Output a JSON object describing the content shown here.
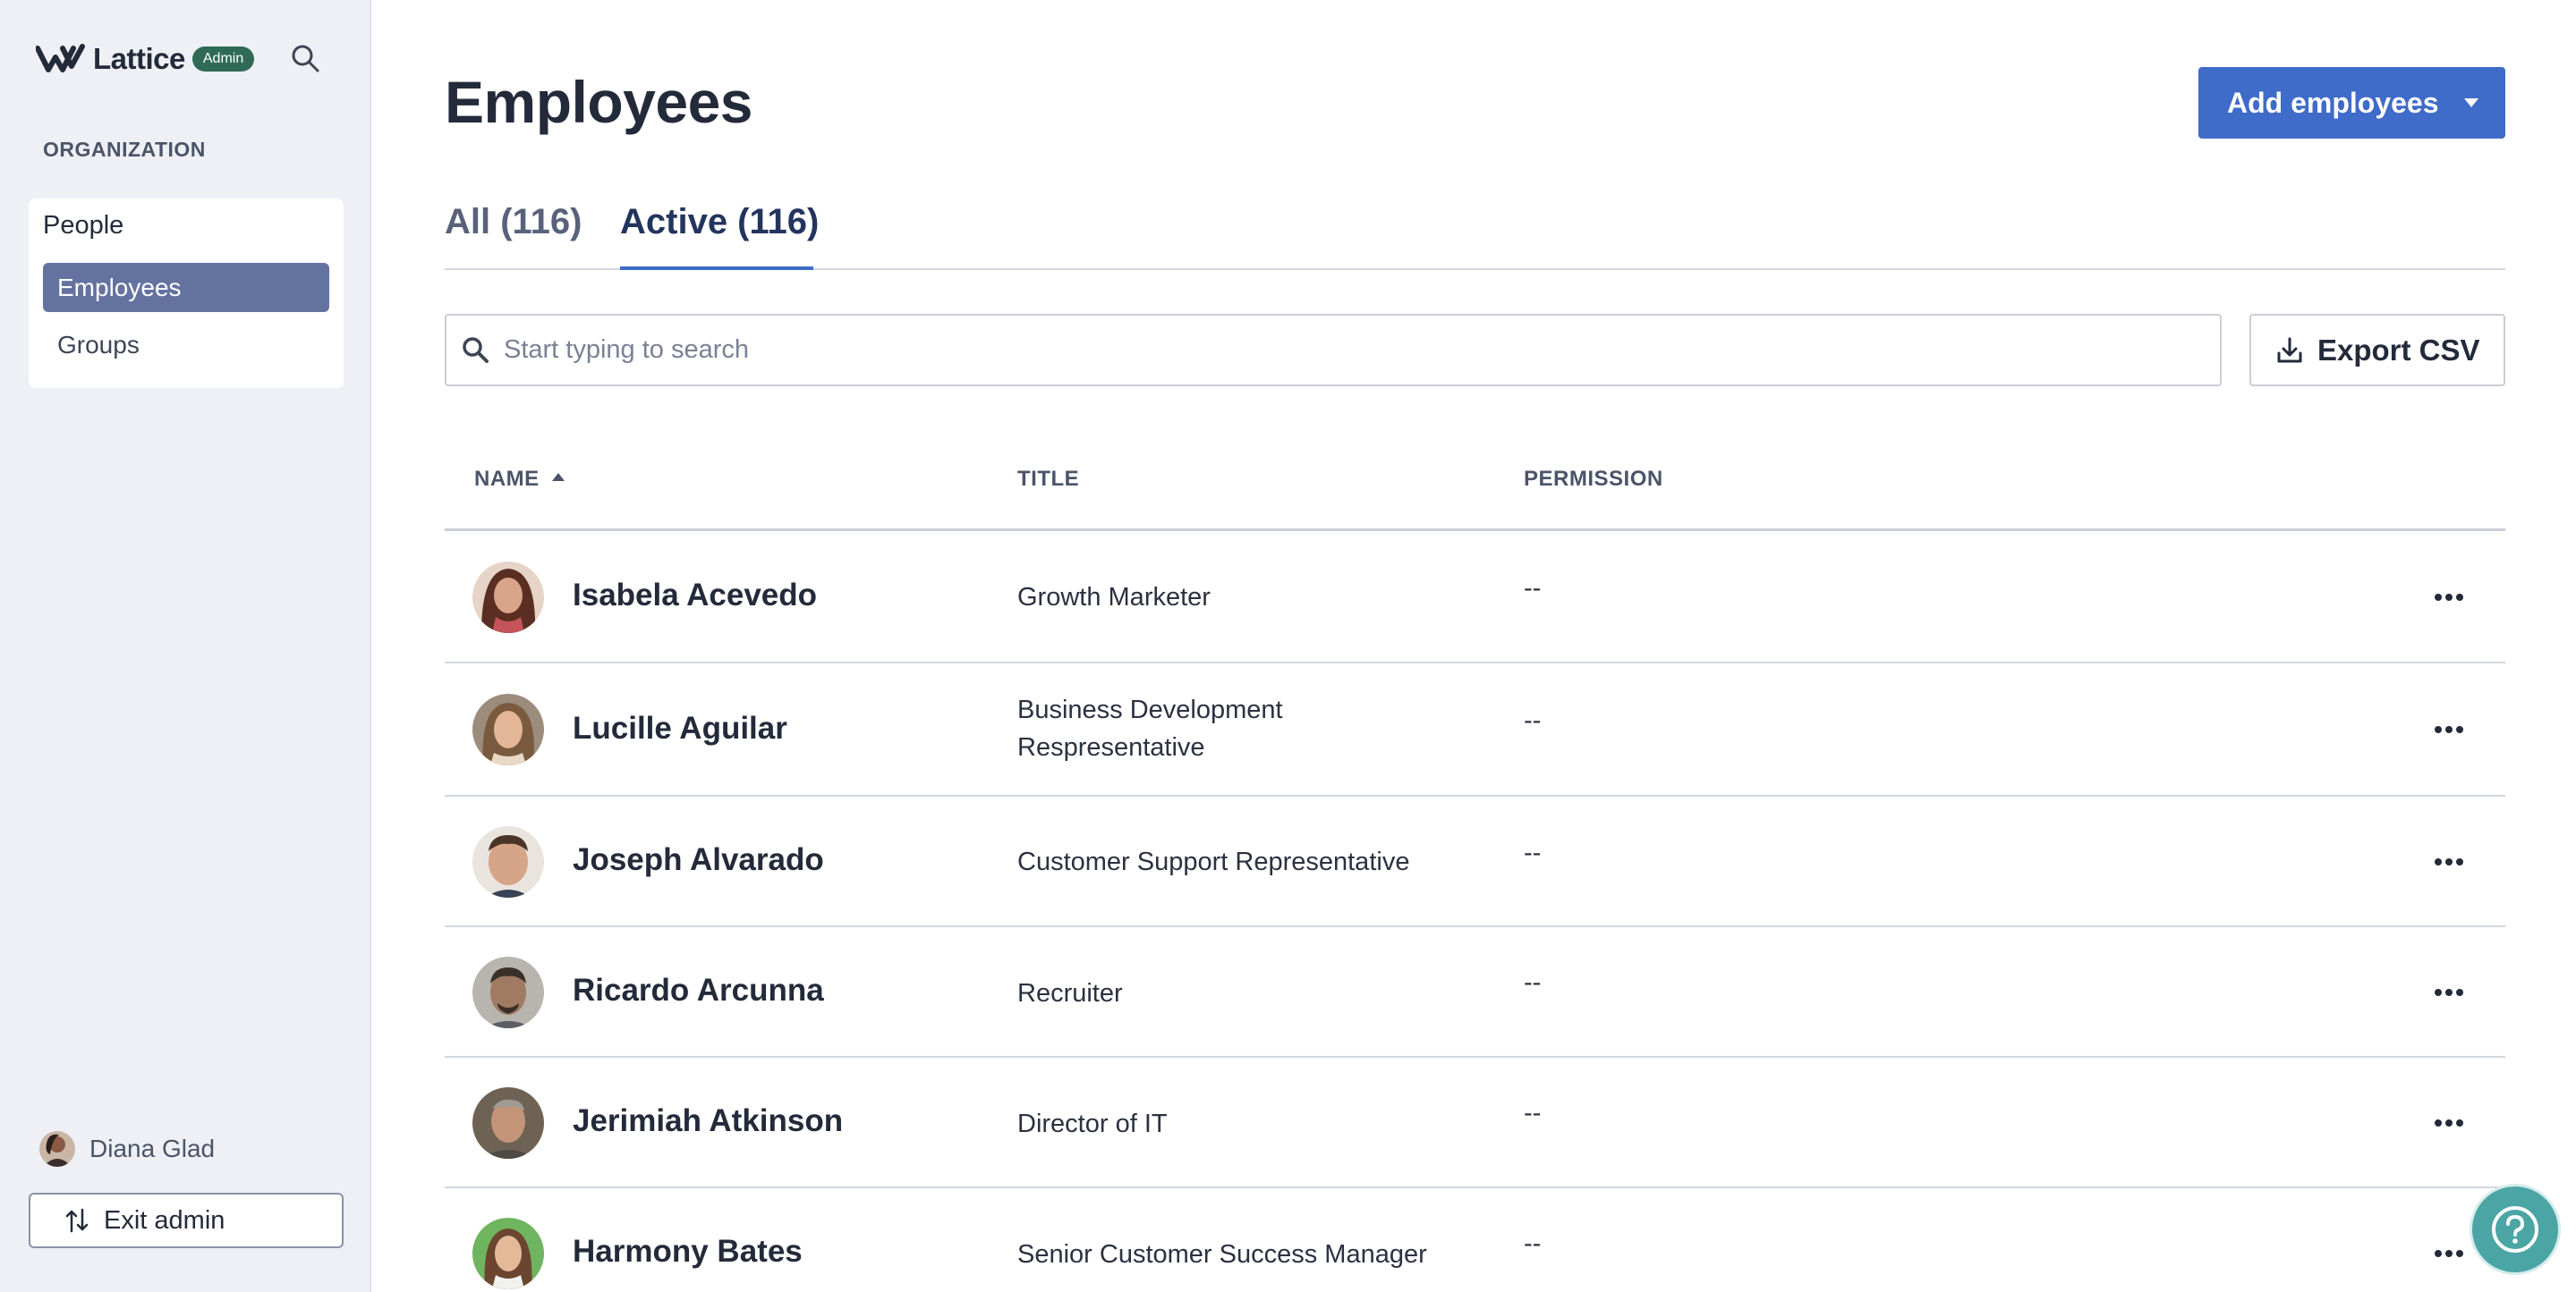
{
  "brand": {
    "name": "Lattice",
    "badge": "Admin"
  },
  "sidebar": {
    "section_label": "ORGANIZATION",
    "group_label": "People",
    "items": [
      {
        "label": "Employees",
        "active": true
      },
      {
        "label": "Groups",
        "active": false
      }
    ],
    "user_name": "Diana Glad",
    "exit_label": "Exit admin"
  },
  "page": {
    "title": "Employees",
    "add_button": "Add employees",
    "tabs": [
      {
        "label": "All (116)",
        "active": false
      },
      {
        "label": "Active (116)",
        "active": true
      }
    ],
    "search_placeholder": "Start typing to search",
    "export_label": "Export CSV"
  },
  "table": {
    "columns": [
      "NAME",
      "TITLE",
      "PERMISSION"
    ],
    "rows": [
      {
        "name": "Isabela Acevedo",
        "title": "Growth Marketer",
        "permission": "--",
        "avatar_color": "#b9705d"
      },
      {
        "name": "Lucille Aguilar",
        "title": "Business Development Respresentative",
        "permission": "--",
        "avatar_color": "#c79a78"
      },
      {
        "name": "Joseph Alvarado",
        "title": "Customer Support Representative",
        "permission": "--",
        "avatar_color": "#d1a88c"
      },
      {
        "name": "Ricardo Arcunna",
        "title": "Recruiter",
        "permission": "--",
        "avatar_color": "#7d7466"
      },
      {
        "name": "Jerimiah Atkinson",
        "title": "Director of IT",
        "permission": "--",
        "avatar_color": "#8c6e5a"
      },
      {
        "name": "Harmony Bates",
        "title": "Senior Customer Success Manager",
        "permission": "--",
        "avatar_color": "#5ea34e"
      }
    ]
  },
  "colors": {
    "accent": "#3f6bc9",
    "sidebar_active": "#6472a0",
    "help": "#4aa5a4",
    "badge": "#2f6a57"
  },
  "icons": {
    "search": "search-icon",
    "download": "download-icon",
    "more": "more-icon",
    "help": "help-icon",
    "exit": "exit-icon"
  }
}
